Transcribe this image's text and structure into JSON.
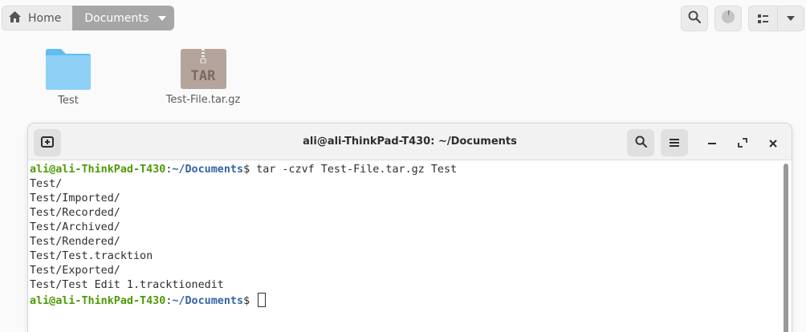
{
  "pathbar": {
    "home_label": "Home",
    "current_label": "Documents"
  },
  "files": [
    {
      "name": "Test",
      "type": "folder"
    },
    {
      "name": "Test-File.tar.gz",
      "type": "archive",
      "badge": "TAR"
    }
  ],
  "icons": {
    "home": "home-icon",
    "dropdown": "chevron-down-icon",
    "search": "search-icon",
    "operations": "progress-pie-icon",
    "view": "list-view-icon",
    "view_options": "chevron-down-icon",
    "new_tab": "new-tab-icon",
    "menu": "hamburger-menu-icon",
    "minimize": "minimize-icon",
    "maximize": "maximize-icon",
    "close": "close-icon"
  },
  "terminal": {
    "title": "ali@ali-ThinkPad-T430: ~/Documents",
    "prompt_user": "ali@ali-ThinkPad-T430",
    "prompt_sep": ":",
    "prompt_path": "~/Documents",
    "prompt_symbol": "$",
    "command": "tar -czvf Test-File.tar.gz Test",
    "output": [
      "Test/",
      "Test/Imported/",
      "Test/Recorded/",
      "Test/Archived/",
      "Test/Rendered/",
      "Test/Test.tracktion",
      "Test/Exported/",
      "Test/Test Edit 1.tracktionedit"
    ]
  },
  "colors": {
    "prompt_user": "#4e9a06",
    "prompt_path": "#3465a4",
    "folder": "#8fd1f6",
    "archive": "#b5a49b"
  }
}
